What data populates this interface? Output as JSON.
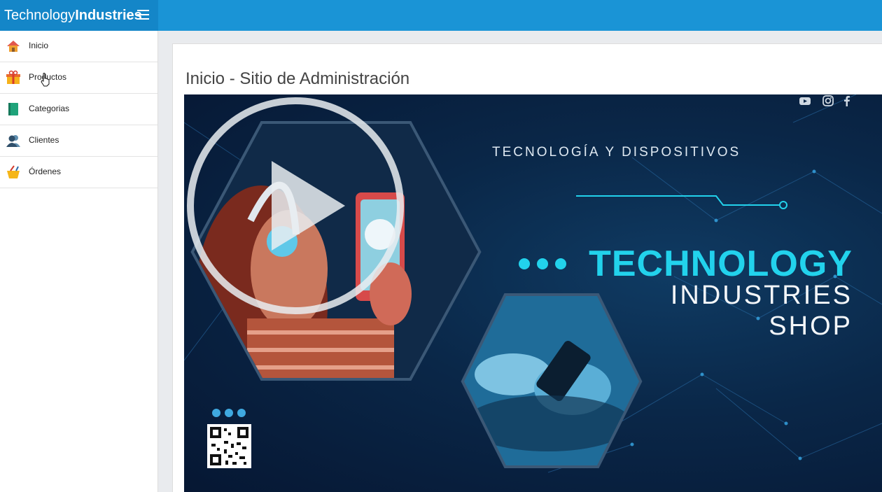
{
  "header": {
    "brand_light": "Technology",
    "brand_bold": "Industries",
    "menu_icon": "hamburger-icon",
    "color": "#1a94d6"
  },
  "sidebar": {
    "items": [
      {
        "label": "Inicio",
        "icon": "home-icon"
      },
      {
        "label": "Productos",
        "icon": "gift-icon"
      },
      {
        "label": "Categorias",
        "icon": "book-icon"
      },
      {
        "label": "Clientes",
        "icon": "users-icon"
      },
      {
        "label": "Órdenes",
        "icon": "cart-icon"
      }
    ]
  },
  "main": {
    "title": "Inicio - Sitio de Administración",
    "banner": {
      "tagline": "TECNOLOGÍA Y DISPOSITIVOS",
      "title_line1": "TECHNOLOGY",
      "title_line2": "INDUSTRIES",
      "title_line3": "SHOP",
      "accent_color": "#22d2ec",
      "social_icons": [
        "youtube-icon",
        "instagram-icon",
        "facebook-icon"
      ],
      "video_overlay": "play-icon"
    }
  }
}
